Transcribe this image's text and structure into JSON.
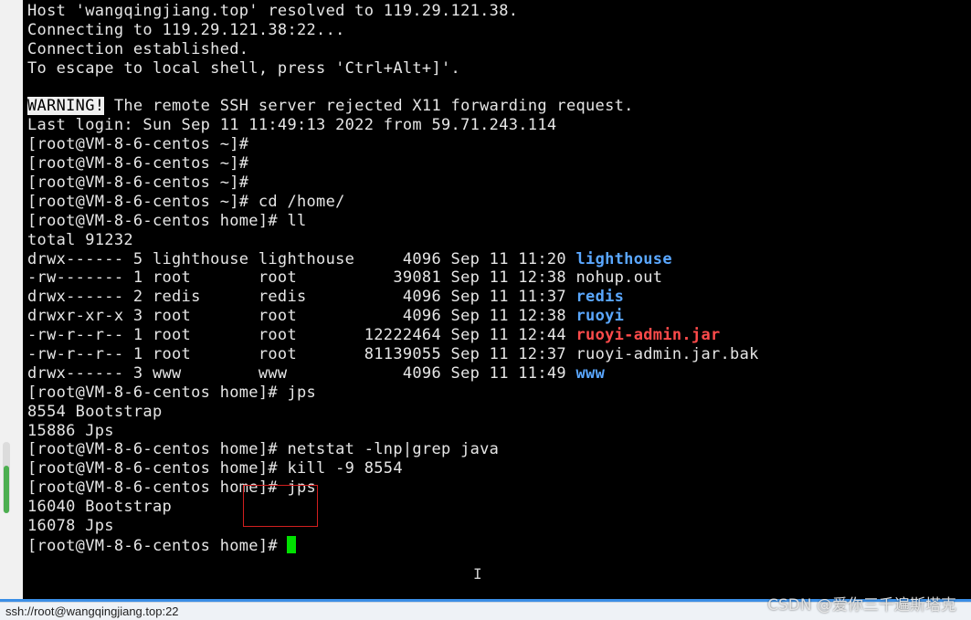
{
  "terminal": {
    "lines": {
      "l0": "Host 'wangqingjiang.top' resolved to 119.29.121.38.",
      "l1": "Connecting to 119.29.121.38:22...",
      "l2": "Connection established.",
      "l3": "To escape to local shell, press 'Ctrl+Alt+]'.",
      "l5_warning": "WARNING!",
      "l5_rest": " The remote SSH server rejected X11 forwarding request.",
      "l6": "Last login: Sun Sep 11 11:49:13 2022 from 59.71.243.114",
      "l7": "[root@VM-8-6-centos ~]#",
      "l8": "[root@VM-8-6-centos ~]#",
      "l9": "[root@VM-8-6-centos ~]#",
      "l10": "[root@VM-8-6-centos ~]# cd /home/",
      "l11": "[root@VM-8-6-centos home]# ll",
      "l12": "total 91232",
      "l20": "[root@VM-8-6-centos home]# jps",
      "l21": "8554 Bootstrap",
      "l22": "15886 Jps",
      "l23": "[root@VM-8-6-centos home]# netstat -lnp|grep java",
      "l24": "[root@VM-8-6-centos home]# kill -9 8554",
      "l25": "[root@VM-8-6-centos home]# jps",
      "l26": "16040 Bootstrap",
      "l27": "16078 Jps",
      "l28": "[root@VM-8-6-centos home]# "
    },
    "listing": [
      {
        "meta": "drwx------ 5 lighthouse lighthouse     4096 Sep 11 11:20 ",
        "name": "lighthouse",
        "kind": "dir"
      },
      {
        "meta": "-rw------- 1 root       root          39081 Sep 11 12:38 ",
        "name": "nohup.out",
        "kind": "file"
      },
      {
        "meta": "drwx------ 2 redis      redis          4096 Sep 11 11:37 ",
        "name": "redis",
        "kind": "dir"
      },
      {
        "meta": "drwxr-xr-x 3 root       root           4096 Sep 11 12:38 ",
        "name": "ruoyi",
        "kind": "dir"
      },
      {
        "meta": "-rw-r--r-- 1 root       root       12222464 Sep 11 12:44 ",
        "name": "ruoyi-admin.jar",
        "kind": "jar"
      },
      {
        "meta": "-rw-r--r-- 1 root       root       81139055 Sep 11 12:37 ",
        "name": "ruoyi-admin.jar.bak",
        "kind": "file"
      },
      {
        "meta": "drwx------ 3 www        www            4096 Sep 11 11:49 ",
        "name": "www",
        "kind": "dir"
      }
    ]
  },
  "colors": {
    "background": "#000000",
    "text": "#e6e6e6",
    "directory": "#5aa7ff",
    "archive": "#ff4b4b",
    "cursor": "#00e000",
    "annotation_box": "#d21f1f"
  },
  "statusbar": {
    "connection": "ssh://root@wangqingjiang.top:22"
  },
  "watermark": {
    "text": "CSDN @爱你三千遍斯塔克"
  }
}
